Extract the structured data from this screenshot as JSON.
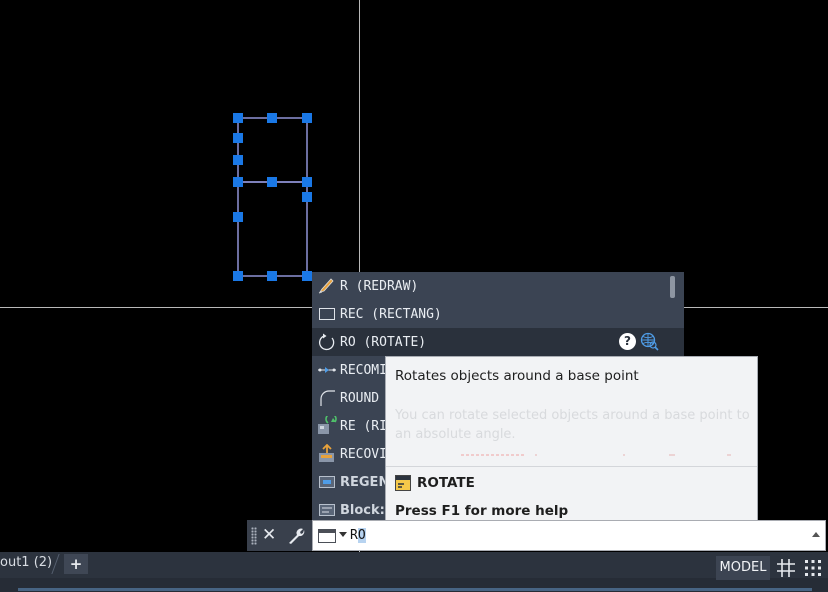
{
  "autocomplete": {
    "items": [
      {
        "label": "R (REDRAW)",
        "icon": "redraw-icon",
        "bold": false,
        "selected": false
      },
      {
        "label": "REC (RECTANG)",
        "icon": "rectangle-icon",
        "bold": false,
        "selected": false
      },
      {
        "label": "RO (ROTATE)",
        "icon": "rotate-icon",
        "bold": false,
        "selected": true
      },
      {
        "label": "RECOMI",
        "icon": "recompute-icon",
        "bold": false,
        "selected": false
      },
      {
        "label": "ROUND",
        "icon": "fillet-icon",
        "bold": false,
        "selected": false
      },
      {
        "label": "RE (RI",
        "icon": "regen-icon",
        "bold": false,
        "selected": false
      },
      {
        "label": "RECOVI",
        "icon": "recover-icon",
        "bold": false,
        "selected": false
      },
      {
        "label": "REGEN",
        "icon": "regen-view-icon",
        "bold": true,
        "selected": false
      },
      {
        "label": "Block:",
        "icon": "block-icon",
        "bold": true,
        "selected": false
      }
    ]
  },
  "tooltip": {
    "title": "Rotates objects around a base point",
    "description": "You can rotate selected objects around a base point to an absolute angle.",
    "command": "ROTATE",
    "help": "Press F1 for more help"
  },
  "command_line": {
    "prefix": "R",
    "highlight": "O"
  },
  "status_bar": {
    "layout_tab": "out1 (2)",
    "add_tab": "+",
    "model": "MODEL"
  },
  "colors": {
    "canvas": "#000000",
    "selection_grip": "#1a78e6",
    "list_bg": "#3b4453",
    "tooltip_bg": "#f2f3f5",
    "status_bg": "#2c333e"
  }
}
